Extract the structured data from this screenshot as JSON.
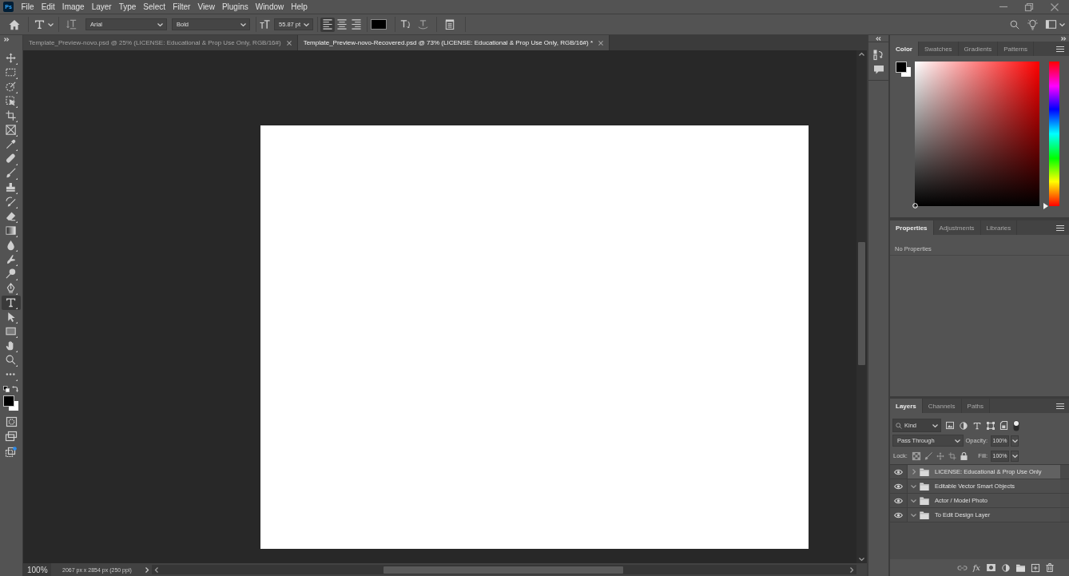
{
  "menu_bar": {
    "logo": "Ps",
    "items": [
      "File",
      "Edit",
      "Image",
      "Layer",
      "Type",
      "Select",
      "Filter",
      "View",
      "Plugins",
      "Window",
      "Help"
    ]
  },
  "options_bar": {
    "font_family": "Arial",
    "font_style": "Bold",
    "font_size": "55.87 pt",
    "alignment": [
      {
        "kind": "left",
        "selected": true
      },
      {
        "kind": "center",
        "selected": false
      },
      {
        "kind": "right",
        "selected": false
      }
    ]
  },
  "document_tabs": [
    {
      "title": "Template_Preview-novo.psd @ 25% (LICENSE: Educational & Prop Use Only, RGB/16#)",
      "selected": false
    },
    {
      "title": "Template_Preview-novo-Recovered.psd @ 73% (LICENSE: Educational & Prop Use Only, RGB/16#) *",
      "selected": true
    }
  ],
  "tools": [
    {
      "kind": "move",
      "selected": false
    },
    {
      "kind": "marquee",
      "selected": false
    },
    {
      "kind": "quick-selection",
      "selected": false
    },
    {
      "kind": "object-selection",
      "selected": false
    },
    {
      "kind": "crop",
      "selected": false
    },
    {
      "kind": "frame",
      "selected": false
    },
    {
      "kind": "eyedropper",
      "selected": false
    },
    {
      "kind": "healing",
      "selected": false
    },
    {
      "kind": "brush",
      "selected": false
    },
    {
      "kind": "stamp",
      "selected": false
    },
    {
      "kind": "history-brush",
      "selected": false
    },
    {
      "kind": "eraser",
      "selected": false
    },
    {
      "kind": "gradient",
      "selected": false
    },
    {
      "kind": "blur",
      "selected": false
    },
    {
      "kind": "smudge",
      "selected": false
    },
    {
      "kind": "dodge",
      "selected": false
    },
    {
      "kind": "pen",
      "selected": false
    },
    {
      "kind": "type",
      "selected": true
    },
    {
      "kind": "path-selection",
      "selected": false
    },
    {
      "kind": "rectangle",
      "selected": false
    },
    {
      "kind": "hand",
      "selected": false
    },
    {
      "kind": "zoom",
      "selected": false
    },
    {
      "kind": "more",
      "selected": false
    }
  ],
  "status_bar": {
    "zoom": "100%",
    "document_info": "2067 px x 2854 px (250 ppi)"
  },
  "color_panel": {
    "tabs": [
      {
        "label": "Color",
        "selected": true
      },
      {
        "label": "Swatches",
        "selected": false
      },
      {
        "label": "Gradients",
        "selected": false
      },
      {
        "label": "Patterns",
        "selected": false
      }
    ],
    "hue_slider": {
      "level": 0
    }
  },
  "properties_panel": {
    "tabs": [
      {
        "label": "Properties",
        "selected": true
      },
      {
        "label": "Adjustments",
        "selected": false
      },
      {
        "label": "Libraries",
        "selected": false
      }
    ],
    "message": "No Properties"
  },
  "layers_panel": {
    "tabs": [
      {
        "label": "Layers",
        "selected": true
      },
      {
        "label": "Channels",
        "selected": false
      },
      {
        "label": "Paths",
        "selected": false
      }
    ],
    "filter": "Kind",
    "blend_mode": "Pass Through",
    "opacity_label": "Opacity:",
    "opacity": "100%",
    "lock_label": "Lock:",
    "fill_label": "Fill:",
    "fill": "100%",
    "layers": [
      {
        "name": "LICENSE: Educational & Prop Use Only",
        "visible": true,
        "expanded": false,
        "selected": true
      },
      {
        "name": "Editable Vector Smart Objects",
        "visible": true,
        "expanded": true,
        "selected": false
      },
      {
        "name": "Actor / Model Photo",
        "visible": true,
        "expanded": true,
        "selected": false
      },
      {
        "name": "To Edit Design Layer",
        "visible": true,
        "expanded": true,
        "selected": false
      }
    ],
    "effects_button": "fx"
  }
}
